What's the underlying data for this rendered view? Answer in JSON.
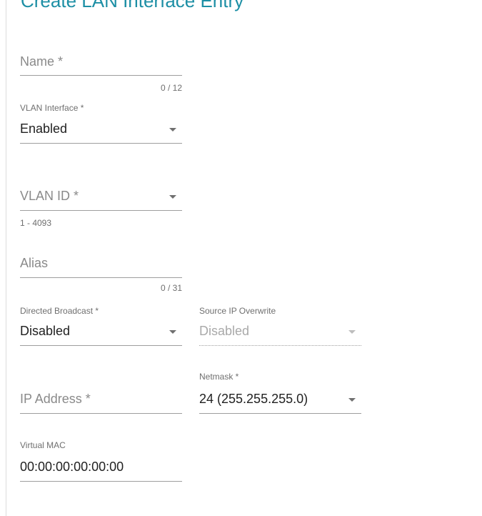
{
  "dialog": {
    "title": "Create LAN Interface Entry"
  },
  "form": {
    "name": {
      "placeholder": "Name *",
      "counter": "0 / 12"
    },
    "vlan_interface": {
      "label": "VLAN Interface *",
      "value": "Enabled"
    },
    "vlan_id": {
      "placeholder": "VLAN ID *",
      "hint": "1 - 4093"
    },
    "alias": {
      "placeholder": "Alias",
      "counter": "0 / 31"
    },
    "directed_broadcast": {
      "label": "Directed Broadcast *",
      "value": "Disabled"
    },
    "source_ip_overwrite": {
      "label": "Source IP Overwrite",
      "value": "Disabled"
    },
    "ip_address": {
      "placeholder": "IP Address *"
    },
    "netmask": {
      "label": "Netmask *",
      "value": "24 (255.255.255.0)"
    },
    "virtual_mac": {
      "label": "Virtual MAC",
      "value": "00:00:00:00:00:00"
    }
  }
}
